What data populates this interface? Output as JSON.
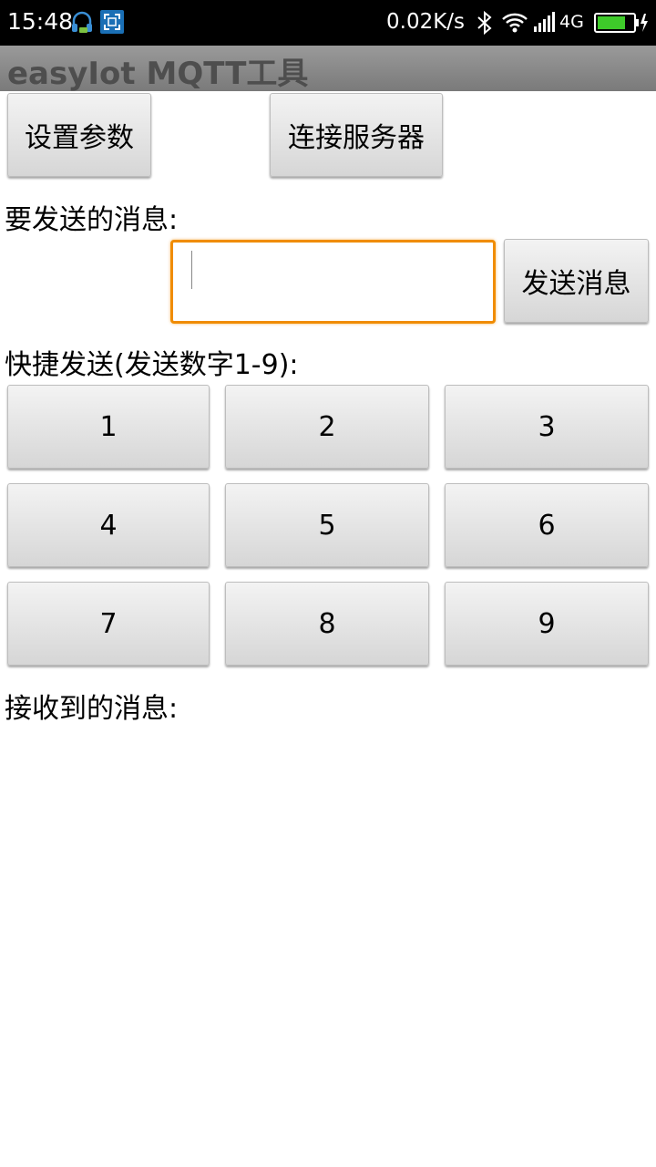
{
  "status_bar": {
    "time": "15:48",
    "net_speed": "0.02K/s",
    "network_type": "4G",
    "icons": [
      "headset-icon",
      "screenshot-icon",
      "bluetooth-icon",
      "wifi-icon",
      "signal-icon",
      "battery-icon"
    ]
  },
  "app": {
    "title": "easyIot MQTT工具"
  },
  "toolbar": {
    "settings_label": "设置参数",
    "connect_label": "连接服务器"
  },
  "send": {
    "label": "要发送的消息:",
    "input_value": "",
    "button_label": "发送消息"
  },
  "quick_send": {
    "label": "快捷发送(发送数字1-9):",
    "buttons": [
      "1",
      "2",
      "3",
      "4",
      "5",
      "6",
      "7",
      "8",
      "9"
    ]
  },
  "received": {
    "label": "接收到的消息:"
  },
  "colors": {
    "status_bar": "#000000",
    "title_bar": "#8a8a8a",
    "input_focus": "#f08c00",
    "battery": "#3ecb2a"
  }
}
